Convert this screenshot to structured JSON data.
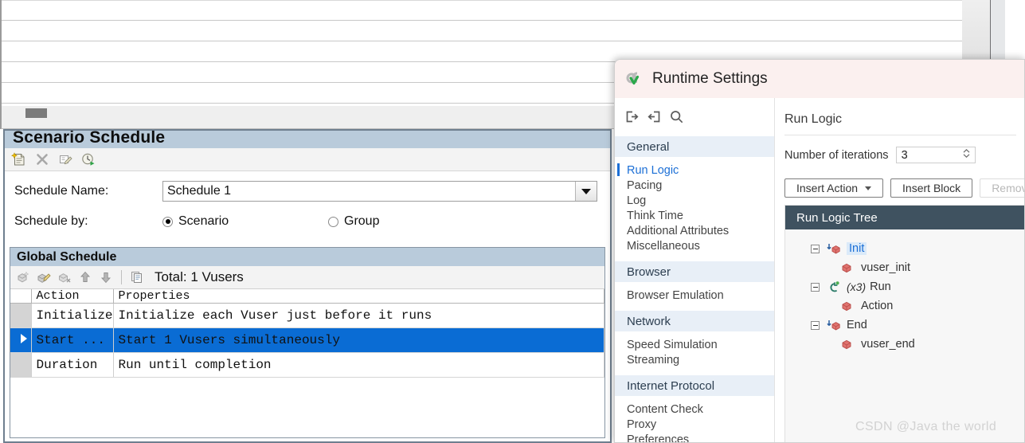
{
  "background_app": {
    "grid_row_count": 5,
    "splitter_grip": "splitter-grip"
  },
  "scenario_schedule": {
    "title": "Scenario Schedule",
    "toolbar": [
      {
        "name": "new-schedule-icon",
        "tooltip": "New Schedule"
      },
      {
        "name": "delete-schedule-icon",
        "tooltip": "Delete Schedule"
      },
      {
        "name": "edit-schedule-icon",
        "tooltip": "Edit Schedule"
      },
      {
        "name": "run-schedule-icon",
        "tooltip": "Run Schedule"
      }
    ],
    "schedule_name_label": "Schedule Name:",
    "schedule_name_value": "Schedule 1",
    "schedule_by_label": "Schedule by:",
    "schedule_by_options": [
      {
        "label": "Scenario",
        "selected": true
      },
      {
        "label": "Group",
        "selected": false
      }
    ]
  },
  "global_schedule": {
    "title": "Global Schedule",
    "toolbar": [
      {
        "name": "add-action-icon",
        "tooltip": "Add Action"
      },
      {
        "name": "edit-action-icon",
        "tooltip": "Edit Action"
      },
      {
        "name": "delete-action-icon",
        "tooltip": "Delete Action"
      },
      {
        "name": "move-up-icon",
        "tooltip": "Move Up"
      },
      {
        "name": "move-down-icon",
        "tooltip": "Move Down"
      },
      {
        "name": "copy-icon",
        "tooltip": "Copy"
      }
    ],
    "total_label": "Total: 1 Vusers",
    "columns": [
      "",
      "Action",
      "Properties"
    ],
    "rows": [
      {
        "marker": "",
        "action": "Initialize",
        "properties": "Initialize each Vuser just before it runs",
        "selected": false
      },
      {
        "marker": "▶",
        "action": "Start  ...",
        "properties": "Start 1 Vusers simultaneously",
        "selected": true
      },
      {
        "marker": "",
        "action": "Duration",
        "properties": "Run until completion",
        "selected": false
      }
    ]
  },
  "runtime_settings": {
    "title": "Runtime Settings",
    "logo": "loadrunner-logo-icon",
    "sidebar_tools": [
      {
        "name": "expand-all-icon",
        "tooltip": "Expand All"
      },
      {
        "name": "collapse-all-icon",
        "tooltip": "Collapse All"
      },
      {
        "name": "search-icon",
        "tooltip": "Search"
      }
    ],
    "sidebar": [
      {
        "type": "group",
        "label": "General"
      },
      {
        "type": "item",
        "label": "Run Logic",
        "active": true
      },
      {
        "type": "item",
        "label": "Pacing",
        "active": false
      },
      {
        "type": "item",
        "label": "Log",
        "active": false
      },
      {
        "type": "item",
        "label": "Think Time",
        "active": false
      },
      {
        "type": "item",
        "label": "Additional Attributes",
        "active": false
      },
      {
        "type": "item",
        "label": "Miscellaneous",
        "active": false
      },
      {
        "type": "group",
        "label": "Browser"
      },
      {
        "type": "item",
        "label": "Browser Emulation",
        "active": false
      },
      {
        "type": "group",
        "label": "Network"
      },
      {
        "type": "item",
        "label": "Speed Simulation",
        "active": false
      },
      {
        "type": "item",
        "label": "Streaming",
        "active": false
      },
      {
        "type": "group",
        "label": "Internet Protocol"
      },
      {
        "type": "item",
        "label": "Content Check",
        "active": false
      },
      {
        "type": "item",
        "label": "Proxy",
        "active": false
      },
      {
        "type": "item",
        "label": "Preferences",
        "active": false
      }
    ],
    "content": {
      "heading": "Run Logic",
      "iterations_label": "Number of iterations",
      "iterations_value": "3",
      "buttons": [
        {
          "label": "Insert Action",
          "has_caret": true,
          "disabled": false
        },
        {
          "label": "Insert Block",
          "has_caret": false,
          "disabled": false
        },
        {
          "label": "Remove",
          "has_caret": false,
          "disabled": true
        },
        {
          "label": "",
          "has_caret": false,
          "disabled": true
        }
      ],
      "tree_title": "Run Logic Tree",
      "tree": [
        {
          "level": 1,
          "label": "Init",
          "icon": "init-block-icon",
          "expandable": true,
          "selected": true,
          "multiplier": ""
        },
        {
          "level": 2,
          "label": "vuser_init",
          "icon": "action-block-icon",
          "expandable": false,
          "selected": false,
          "multiplier": ""
        },
        {
          "level": 1,
          "label": "Run",
          "icon": "run-loop-icon",
          "expandable": true,
          "selected": false,
          "multiplier": "(x3)"
        },
        {
          "level": 2,
          "label": "Action",
          "icon": "action-block-icon",
          "expandable": false,
          "selected": false,
          "multiplier": ""
        },
        {
          "level": 1,
          "label": "End",
          "icon": "end-block-icon",
          "expandable": true,
          "selected": false,
          "multiplier": ""
        },
        {
          "level": 2,
          "label": "vuser_end",
          "icon": "action-block-icon",
          "expandable": false,
          "selected": false,
          "multiplier": ""
        }
      ]
    }
  },
  "watermark": "CSDN @Java the world",
  "colors": {
    "dialog_header_bg": "#fbf0ef",
    "tree_header_bg": "#3f5260",
    "panel_title_bg": "#b9cbdb",
    "selected_row_bg": "#0a6cd4",
    "accent_blue": "#1c6fd6",
    "group_bg": "#e8eff7"
  }
}
